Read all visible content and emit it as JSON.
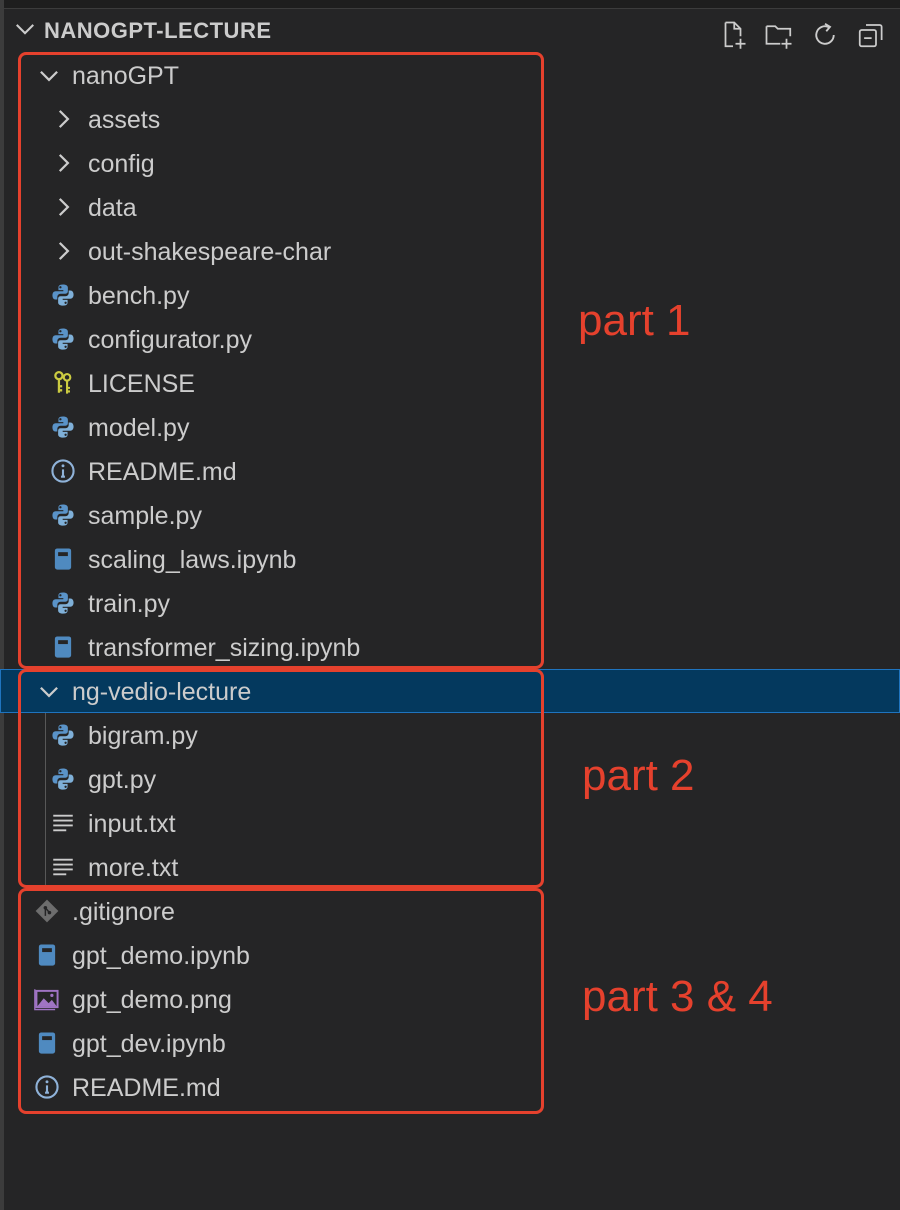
{
  "explorer": {
    "title": "NANOGPT-LECTURE",
    "actions": [
      {
        "icon": "new-file-icon"
      },
      {
        "icon": "new-folder-icon"
      },
      {
        "icon": "refresh-icon"
      },
      {
        "icon": "collapse-all-icon"
      }
    ]
  },
  "tree": [
    {
      "label": "nanoGPT",
      "type": "folder-open",
      "depth": 0
    },
    {
      "label": "assets",
      "type": "folder-closed",
      "depth": 1
    },
    {
      "label": "config",
      "type": "folder-closed",
      "depth": 1
    },
    {
      "label": "data",
      "type": "folder-closed",
      "depth": 1
    },
    {
      "label": "out-shakespeare-char",
      "type": "folder-closed",
      "depth": 1
    },
    {
      "label": "bench.py",
      "type": "python",
      "depth": 1
    },
    {
      "label": "configurator.py",
      "type": "python",
      "depth": 1
    },
    {
      "label": "LICENSE",
      "type": "license",
      "depth": 1
    },
    {
      "label": "model.py",
      "type": "python",
      "depth": 1
    },
    {
      "label": "README.md",
      "type": "info",
      "depth": 1
    },
    {
      "label": "sample.py",
      "type": "python",
      "depth": 1
    },
    {
      "label": "scaling_laws.ipynb",
      "type": "notebook",
      "depth": 1
    },
    {
      "label": "train.py",
      "type": "python",
      "depth": 1
    },
    {
      "label": "transformer_sizing.ipynb",
      "type": "notebook",
      "depth": 1
    },
    {
      "label": "ng-vedio-lecture",
      "type": "folder-open",
      "depth": 0,
      "selected": true
    },
    {
      "label": "bigram.py",
      "type": "python",
      "depth": 1
    },
    {
      "label": "gpt.py",
      "type": "python",
      "depth": 1
    },
    {
      "label": "input.txt",
      "type": "text",
      "depth": 1
    },
    {
      "label": "more.txt",
      "type": "text",
      "depth": 1
    },
    {
      "label": ".gitignore",
      "type": "git",
      "depth": 0,
      "root": true
    },
    {
      "label": "gpt_demo.ipynb",
      "type": "notebook",
      "depth": 0,
      "root": true
    },
    {
      "label": "gpt_demo.png",
      "type": "image",
      "depth": 0,
      "root": true
    },
    {
      "label": "gpt_dev.ipynb",
      "type": "notebook",
      "depth": 0,
      "root": true
    },
    {
      "label": "README.md",
      "type": "info",
      "depth": 0,
      "root": true
    }
  ],
  "annotations": [
    {
      "label": "part 1"
    },
    {
      "label": "part 2"
    },
    {
      "label": "part 3 & 4"
    }
  ],
  "colors": {
    "annotation": "#e5412d",
    "python": "#4b8bbe",
    "notebook": "#4f8ac0",
    "license": "#cbcb41",
    "image": "#a074c4",
    "git": "#6d6d6d",
    "selection": "#04395e"
  }
}
